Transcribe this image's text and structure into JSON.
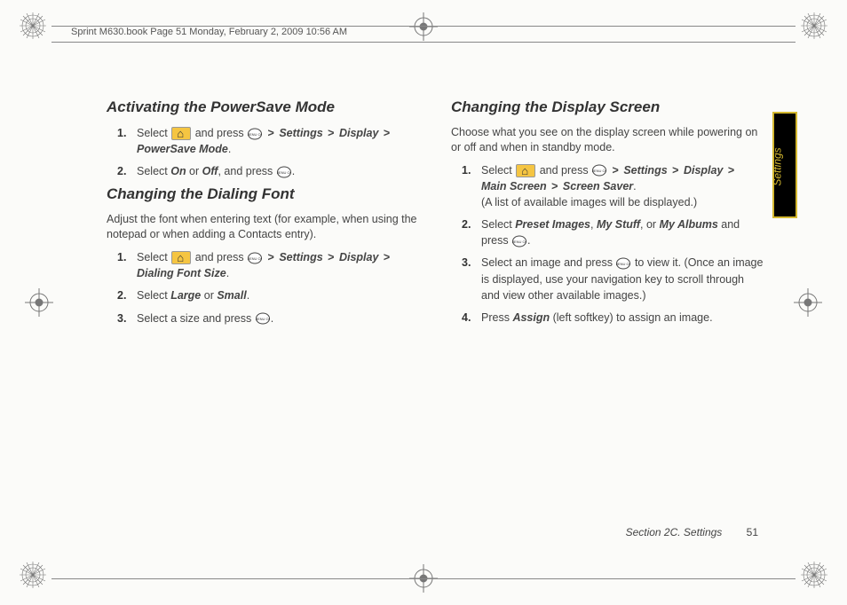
{
  "header": "Sprint M630.book  Page 51  Monday, February 2, 2009  10:56 AM",
  "left": {
    "h1": "Activating the PowerSave Mode",
    "s1_a": "Select ",
    "s1_b": " and press ",
    "s1_path": "Settings > Display > PowerSave Mode",
    "s2_a": "Select ",
    "s2_on": "On",
    "s2_or": " or ",
    "s2_off": "Off",
    "s2_b": ", and press ",
    "h2": "Changing the Dialing Font",
    "intro2": "Adjust the font when entering text (for example, when using the notepad or when adding a Contacts entry).",
    "s3_a": "Select ",
    "s3_b": " and press ",
    "s3_path": "Settings > Display > Dialing Font Size",
    "s4_a": "Select ",
    "s4_large": "Large",
    "s4_or": " or ",
    "s4_small": "Small",
    "s5_a": "Select a size and press "
  },
  "right": {
    "h1": "Changing the Display Screen",
    "intro1": "Choose what you see on the display screen while powering on or off and when in standby mode.",
    "s1_a": "Select ",
    "s1_b": " and press ",
    "s1_path": "Settings > Display > Main Screen > Screen Saver",
    "s1_note": "(A list of available images will be displayed.)",
    "s2_a": "Select ",
    "s2_preset": "Preset Images",
    "s2_c1": ", ",
    "s2_mystuff": "My Stuff",
    "s2_c2": ", or ",
    "s2_albums": "My Albums",
    "s2_b": " and press ",
    "s3_a": "Select an image and press ",
    "s3_b": " to view it. (Once an image is displayed, use your navigation key to scroll through and view other available images.)",
    "s4_a": "Press ",
    "s4_assign": "Assign",
    "s4_b": " (left softkey) to assign an image."
  },
  "footer": {
    "section": "Section 2C. Settings",
    "page": "51"
  },
  "sidetab": "Settings"
}
